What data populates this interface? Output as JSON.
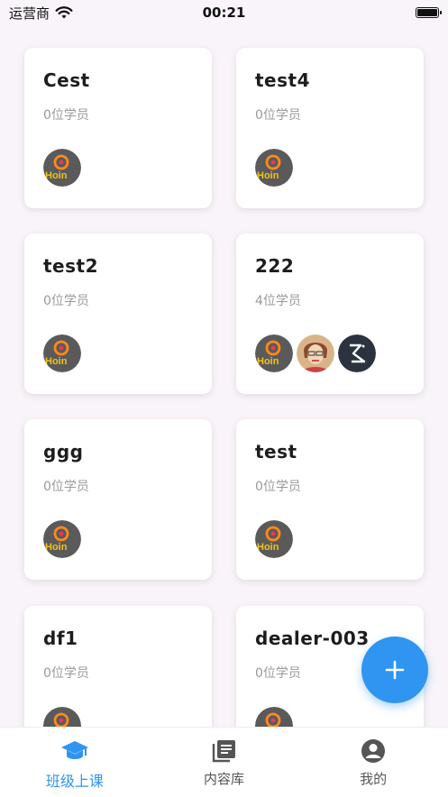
{
  "status": {
    "carrier": "运营商",
    "time": "00:21"
  },
  "classes": [
    {
      "name": "Cest",
      "count": "0位学员",
      "avatars": [
        "hoin"
      ]
    },
    {
      "name": "test4",
      "count": "0位学员",
      "avatars": [
        "hoin"
      ]
    },
    {
      "name": "test2",
      "count": "0位学员",
      "avatars": [
        "hoin"
      ]
    },
    {
      "name": "222",
      "count": "4位学员",
      "avatars": [
        "hoin",
        "person",
        "logo"
      ]
    },
    {
      "name": "ggg",
      "count": "0位学员",
      "avatars": [
        "hoin"
      ]
    },
    {
      "name": "test",
      "count": "0位学员",
      "avatars": [
        "hoin"
      ]
    },
    {
      "name": "df1",
      "count": "0位学员",
      "avatars": [
        "hoin"
      ]
    },
    {
      "name": "dealer-003",
      "count": "0位学员",
      "avatars": [
        "hoin"
      ]
    }
  ],
  "avatar_text": "Hoin",
  "tabs": [
    {
      "label": "班级上课",
      "icon": "graduation-cap-icon",
      "active": true
    },
    {
      "label": "内容库",
      "icon": "library-icon",
      "active": false
    },
    {
      "label": "我的",
      "icon": "user-circle-icon",
      "active": false
    }
  ],
  "colors": {
    "accent": "#2f95f0",
    "inactive": "#555555",
    "muted_text": "#9a9a9a"
  }
}
